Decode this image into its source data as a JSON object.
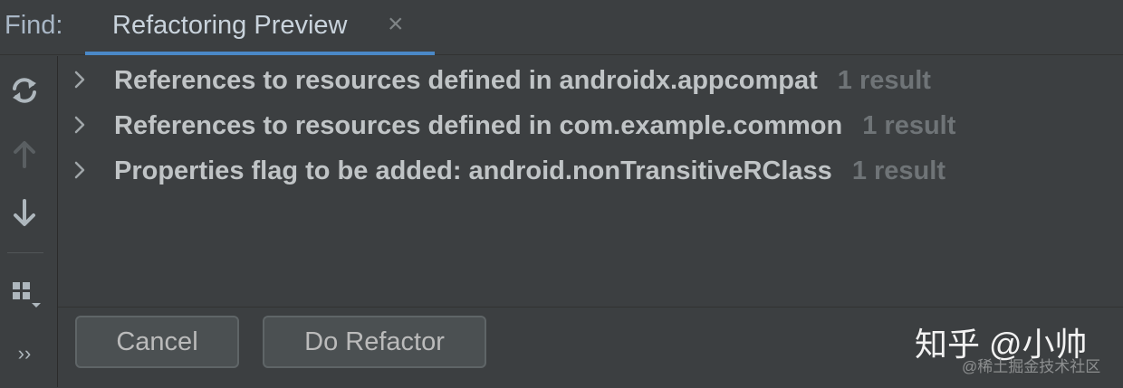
{
  "header": {
    "find_label": "Find:",
    "tab_label": "Refactoring Preview",
    "tab_close": "×"
  },
  "toolbar": {
    "items": [
      "rerun-icon",
      "up-arrow-icon",
      "down-arrow-icon",
      "group-icon",
      "more-icon"
    ],
    "more_label": "››"
  },
  "results": [
    {
      "label": "References to resources defined in androidx.appcompat",
      "count": "1 result"
    },
    {
      "label": "References to resources defined in com.example.common",
      "count": "1 result"
    },
    {
      "label": "Properties flag to be added: android.nonTransitiveRClass",
      "count": "1 result"
    }
  ],
  "footer": {
    "cancel_label": "Cancel",
    "do_refactor_label": "Do Refactor"
  },
  "watermark": {
    "main": "知乎 @小帅",
    "sub": "@稀土掘金技术社区"
  },
  "colors": {
    "background": "#3c3f41",
    "tab_underline": "#4a88c7",
    "count_text": "#6f7477"
  }
}
